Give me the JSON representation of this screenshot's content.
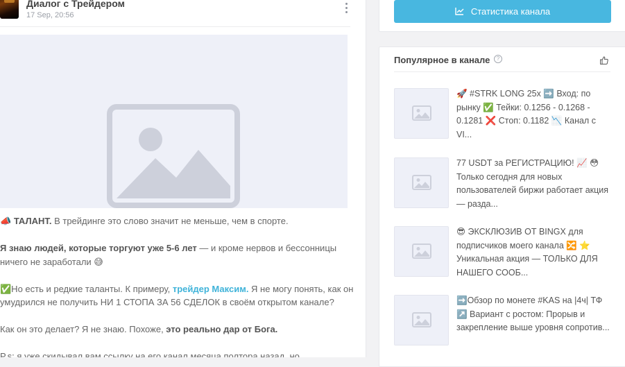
{
  "post": {
    "channel_name": "Диалог с Трейдером",
    "date": "17 Sep, 20:56",
    "icon_menu": "kebab-menu-icon",
    "image_placeholder_icon": "image-placeholder-icon",
    "paragraphs": [
      {
        "lead": "📣 ",
        "bold": "ТАЛАНТ.",
        "rest": " В трейдинге это слово значит не меньше, чем в спорте."
      },
      {
        "bold": "Я знаю людей, которые торгуют уже 5-6 лет",
        "rest_line1": " — и кроме нервов и бессонницы",
        "line2": "ничего не заработали 😅"
      },
      {
        "part1": "✅Но есть и редкие таланты. К примеру, ",
        "link": "трейдер Максим.",
        "part2": " Я не могу понять, как он",
        "line2": "умудрился не получить НИ 1 СТОПА ЗА 56 СДЕЛОК в своём открытом канале?"
      },
      {
        "part1": "Как он это делает? Я не знаю. Похоже, ",
        "bold": "это реально дар от Бога."
      },
      {
        "text": "P.s: я уже скидывал вам ссылку на его канал месяца полтора назад, но"
      }
    ]
  },
  "sidebar": {
    "stats_button_label": "Статистика канала",
    "stats_icon": "line-chart-icon",
    "popular_title": "Популярное в канале",
    "help_icon": "question-circle-icon",
    "help_glyph": "?",
    "like_icon": "thumbs-up-icon",
    "items": [
      {
        "text": "🚀 #STRK LONG 25x ➡️ Вход: по рынку ✅ Тейки: 0.1256 - 0.1268 - 0.1281 ❌ Стоп: 0.1182 📉 Канал с VI..."
      },
      {
        "text": "77 USDT за РЕГИСТРАЦИЮ! 📈 😳 Только сегодня для новых пользователей биржи работает акция — разда..."
      },
      {
        "text": "😎 ЭКСКЛЮЗИВ ОТ BINGX для подписчиков моего канала 🔀 ⭐ Уникальная акция — ТОЛЬКО ДЛЯ НАШЕГО СООБ..."
      },
      {
        "text": "➡️Обзор по монете #KAS на |4ч| ТФ ↗️ Вариант с ростом: Прорыв и закрепление выше уровня сопротив..."
      }
    ],
    "thumb_icon": "image-placeholder-icon"
  }
}
